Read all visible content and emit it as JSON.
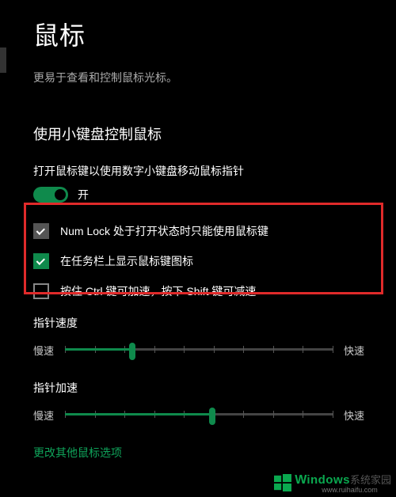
{
  "page": {
    "title": "鼠标",
    "subtitle": "更易于查看和控制鼠标光标。"
  },
  "section": {
    "title": "使用小键盘控制鼠标",
    "toggle_desc": "打开鼠标键以使用数字小键盘移动鼠标指针",
    "toggle_state": "开",
    "checkbox1": "Num Lock 处于打开状态时只能使用鼠标键",
    "checkbox2": "在任务栏上显示鼠标键图标",
    "checkbox3": "按住 Ctrl 键可加速，按下 Shift 键可减速"
  },
  "sliders": {
    "speed_title": "指针速度",
    "accel_title": "指针加速",
    "slow": "慢速",
    "fast": "快速",
    "speed_value": 25,
    "accel_value": 55
  },
  "link": "更改其他鼠标选项",
  "watermark": {
    "brand": "indows",
    "small": "系统家园",
    "url": "www.ruihaifu.com"
  }
}
